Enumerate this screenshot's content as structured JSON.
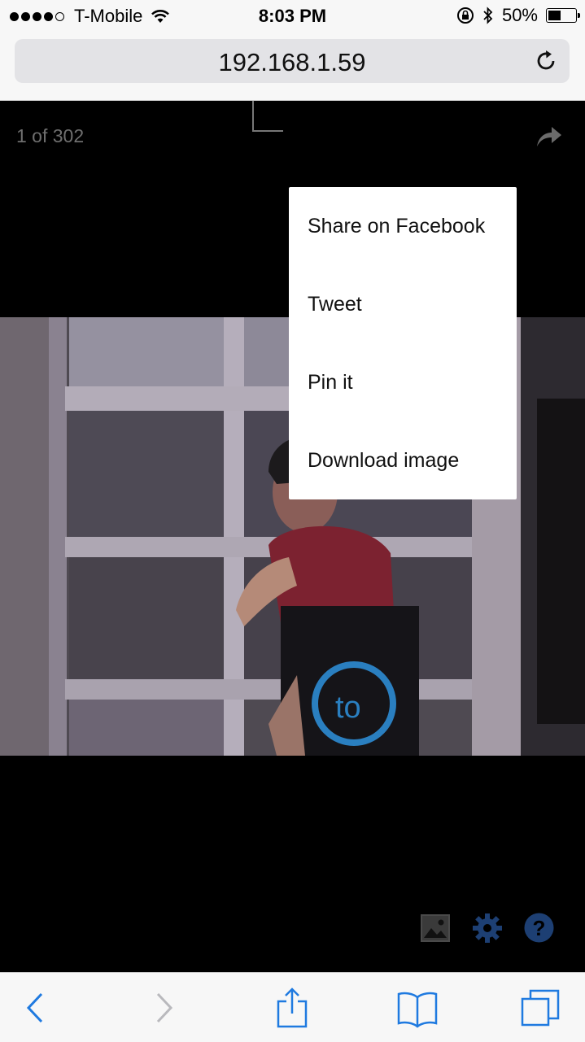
{
  "status_bar": {
    "carrier": "T-Mobile",
    "signal_bars_filled": 4,
    "signal_bars_total": 5,
    "time": "8:03 PM",
    "battery_percent_label": "50%",
    "battery_level": 0.5
  },
  "url_bar": {
    "address": "192.168.1.59"
  },
  "viewer": {
    "counter": "1 of 302"
  },
  "share_menu": {
    "items": [
      {
        "label": "Share on Facebook"
      },
      {
        "label": "Tweet"
      },
      {
        "label": "Pin it"
      },
      {
        "label": "Download image"
      }
    ]
  },
  "icons": {
    "share": "share-arrow-icon",
    "gallery": "image-icon",
    "settings": "gear-icon",
    "help": "question-mark-icon",
    "back": "chevron-left-icon",
    "forward": "chevron-right-icon",
    "share_sheet": "share-box-icon",
    "bookmarks": "book-icon",
    "tabs": "tabs-icon"
  },
  "colors": {
    "ios_blue": "#1f7ae0",
    "dark_blue_icon": "#1d3f73",
    "bag_logo": "#2a7fc0"
  }
}
